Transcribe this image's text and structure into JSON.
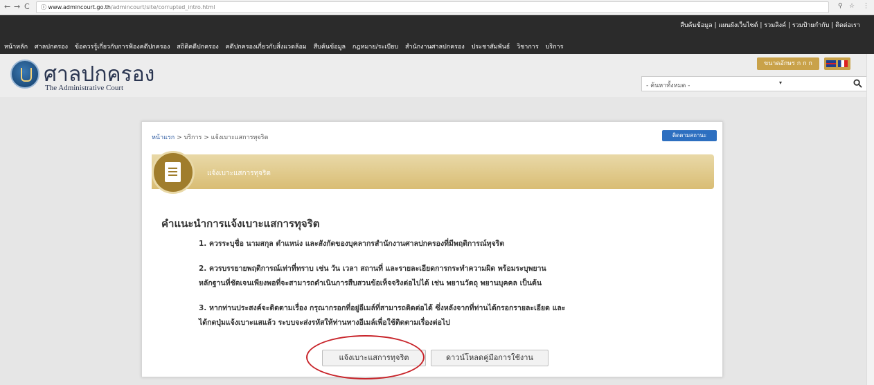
{
  "browser": {
    "url_host": "www.admincourt.go.th",
    "url_path": "/admincourt/site/corrupted_intro.html",
    "nav_back": "←",
    "nav_forward": "→",
    "nav_reload": "C",
    "info": "ⓘ"
  },
  "header": {
    "top_links": "สืบค้นข้อมูล | แผนผังเว็บไซต์ | รวมลิงค์ | รวมป้ายกำกับ | ติดต่อเรา",
    "nav": [
      "หน้าหลัก",
      "ศาลปกครอง",
      "ข้อควรรู้เกี่ยวกับการฟ้องคดีปกครอง",
      "สถิติคดีปกครอง",
      "คดีปกครองเกี่ยวกับสิ่งแวดล้อม",
      "สืบค้นข้อมูล",
      "กฎหมาย/ระเบียบ",
      "สำนักงานศาลปกครอง",
      "ประชาสัมพันธ์",
      "วิชาการ",
      "บริการ"
    ],
    "brand_th": "ศาลปกครอง",
    "brand_en": "The Administrative Court",
    "font_size_label": "ขนาดอักษร ก ก ก",
    "search_scope": "- ค้นหาทั้งหมด -",
    "search_caret": "▾"
  },
  "card": {
    "breadcrumb": {
      "home": "หน้าแรก",
      "sep1": " > ",
      "service": "บริการ",
      "sep2": " > ",
      "current": "แจ้งเบาะแสการทุจริต"
    },
    "track_button": "ติดตามสถานะ",
    "band_title": "แจ้งเบาะแสการทุจริต",
    "heading": "คำแนะนำการแจ้งเบาะแสการทุจริต",
    "items": [
      "1. ควรระบุชื่อ นามสกุล ตำแหน่ง และสังกัดของบุคลากรสำนักงานศาลปกครองที่มีพฤติการณ์ทุจริต",
      "2. ควรบรรยายพฤติการณ์เท่าที่ทราบ เช่น วัน เวลา สถานที่ และรายละเอียดการกระทำความผิด พร้อมระบุพยาน",
      "หลักฐานที่ชัดเจนเพียงพอที่จะสามารถดำเนินการสืบสวนข้อเท็จจริงต่อไปได้ เช่น พยานวัตถุ พยานบุคคล เป็นต้น",
      "3. หากท่านประสงค์จะติดตามเรื่อง กรุณากรอกที่อยู่อีเมล์ที่สามารถติดต่อได้ ซึ่งหลังจากที่ท่านได้กรอกรายละเอียด และ",
      "ได้กดปุ่มแจ้งเบาะแสแล้ว ระบบจะส่งรหัสให้ท่านทางอีเมล์เพื่อใช้ติดตามเรื่องต่อไป"
    ],
    "report_button": "แจ้งเบาะแสการทุจริต",
    "download_button": "ดาวน์โหลดคู่มือการใช้งาน"
  },
  "colors": {
    "header_bg": "#2b2b2b",
    "gold": "#c9a24a",
    "accent_blue": "#2d6fc0",
    "highlight_red": "#c8242a"
  }
}
